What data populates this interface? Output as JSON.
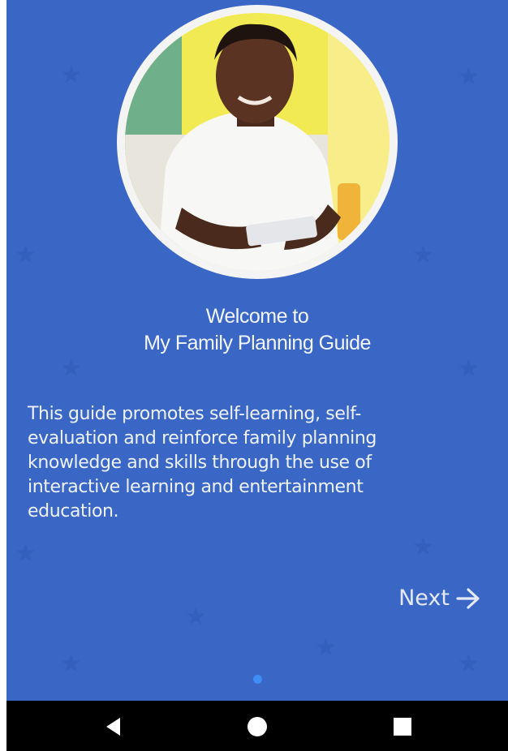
{
  "welcome": {
    "line1": "Welcome to",
    "line2": "My Family Planning Guide"
  },
  "description": "This guide promotes self-learning, self-evaluation and reinforce family planning knowledge and skills through the use of interactive learning and entertainment education.",
  "next_label": "Next",
  "pager": {
    "total_pages": 1,
    "current_page": 1
  },
  "icons": {
    "next": "arrow-right-icon",
    "nav_back": "back-triangle-icon",
    "nav_home": "home-circle-icon",
    "nav_recents": "recents-square-icon"
  },
  "colors": {
    "background": "#3a66c6",
    "text": "#f3f6fc",
    "dot_active": "#3e8df5",
    "navbar": "#000000"
  }
}
